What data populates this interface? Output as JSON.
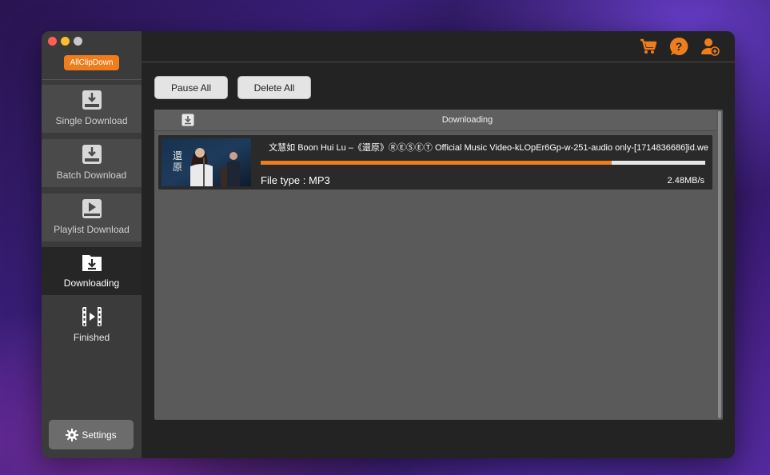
{
  "app": {
    "brand_label": "AllClipDown"
  },
  "sidebar": {
    "items": [
      {
        "label": "Single Download",
        "icon": "single-download-icon"
      },
      {
        "label": "Batch Download",
        "icon": "batch-download-icon"
      },
      {
        "label": "Playlist Download",
        "icon": "playlist-icon"
      },
      {
        "label": "Downloading",
        "icon": "downloading-icon",
        "active": true
      },
      {
        "label": "Finished",
        "icon": "finished-film-icon"
      }
    ],
    "settings_label": "Settings"
  },
  "toolbar": {
    "pause_all_label": "Pause All",
    "delete_all_label": "Delete All",
    "icons": [
      "cart-icon",
      "help-icon",
      "account-icon"
    ]
  },
  "list": {
    "header_title": "Downloading",
    "items": [
      {
        "title": "文慧如 Boon Hui Lu –《還原》ⓇⒺⓈⒺⓉ Official Music Video-kLOpEr6Gp-w-251-audio only-[1714836686]id.we",
        "file_type_label": "File type :",
        "file_type": "MP3",
        "speed": "2.48MB/s",
        "progress": 0.79
      }
    ]
  },
  "colors": {
    "accent": "#f07d1c",
    "sidebar_bg": "#3b3b3b",
    "window_bg": "#232323"
  }
}
